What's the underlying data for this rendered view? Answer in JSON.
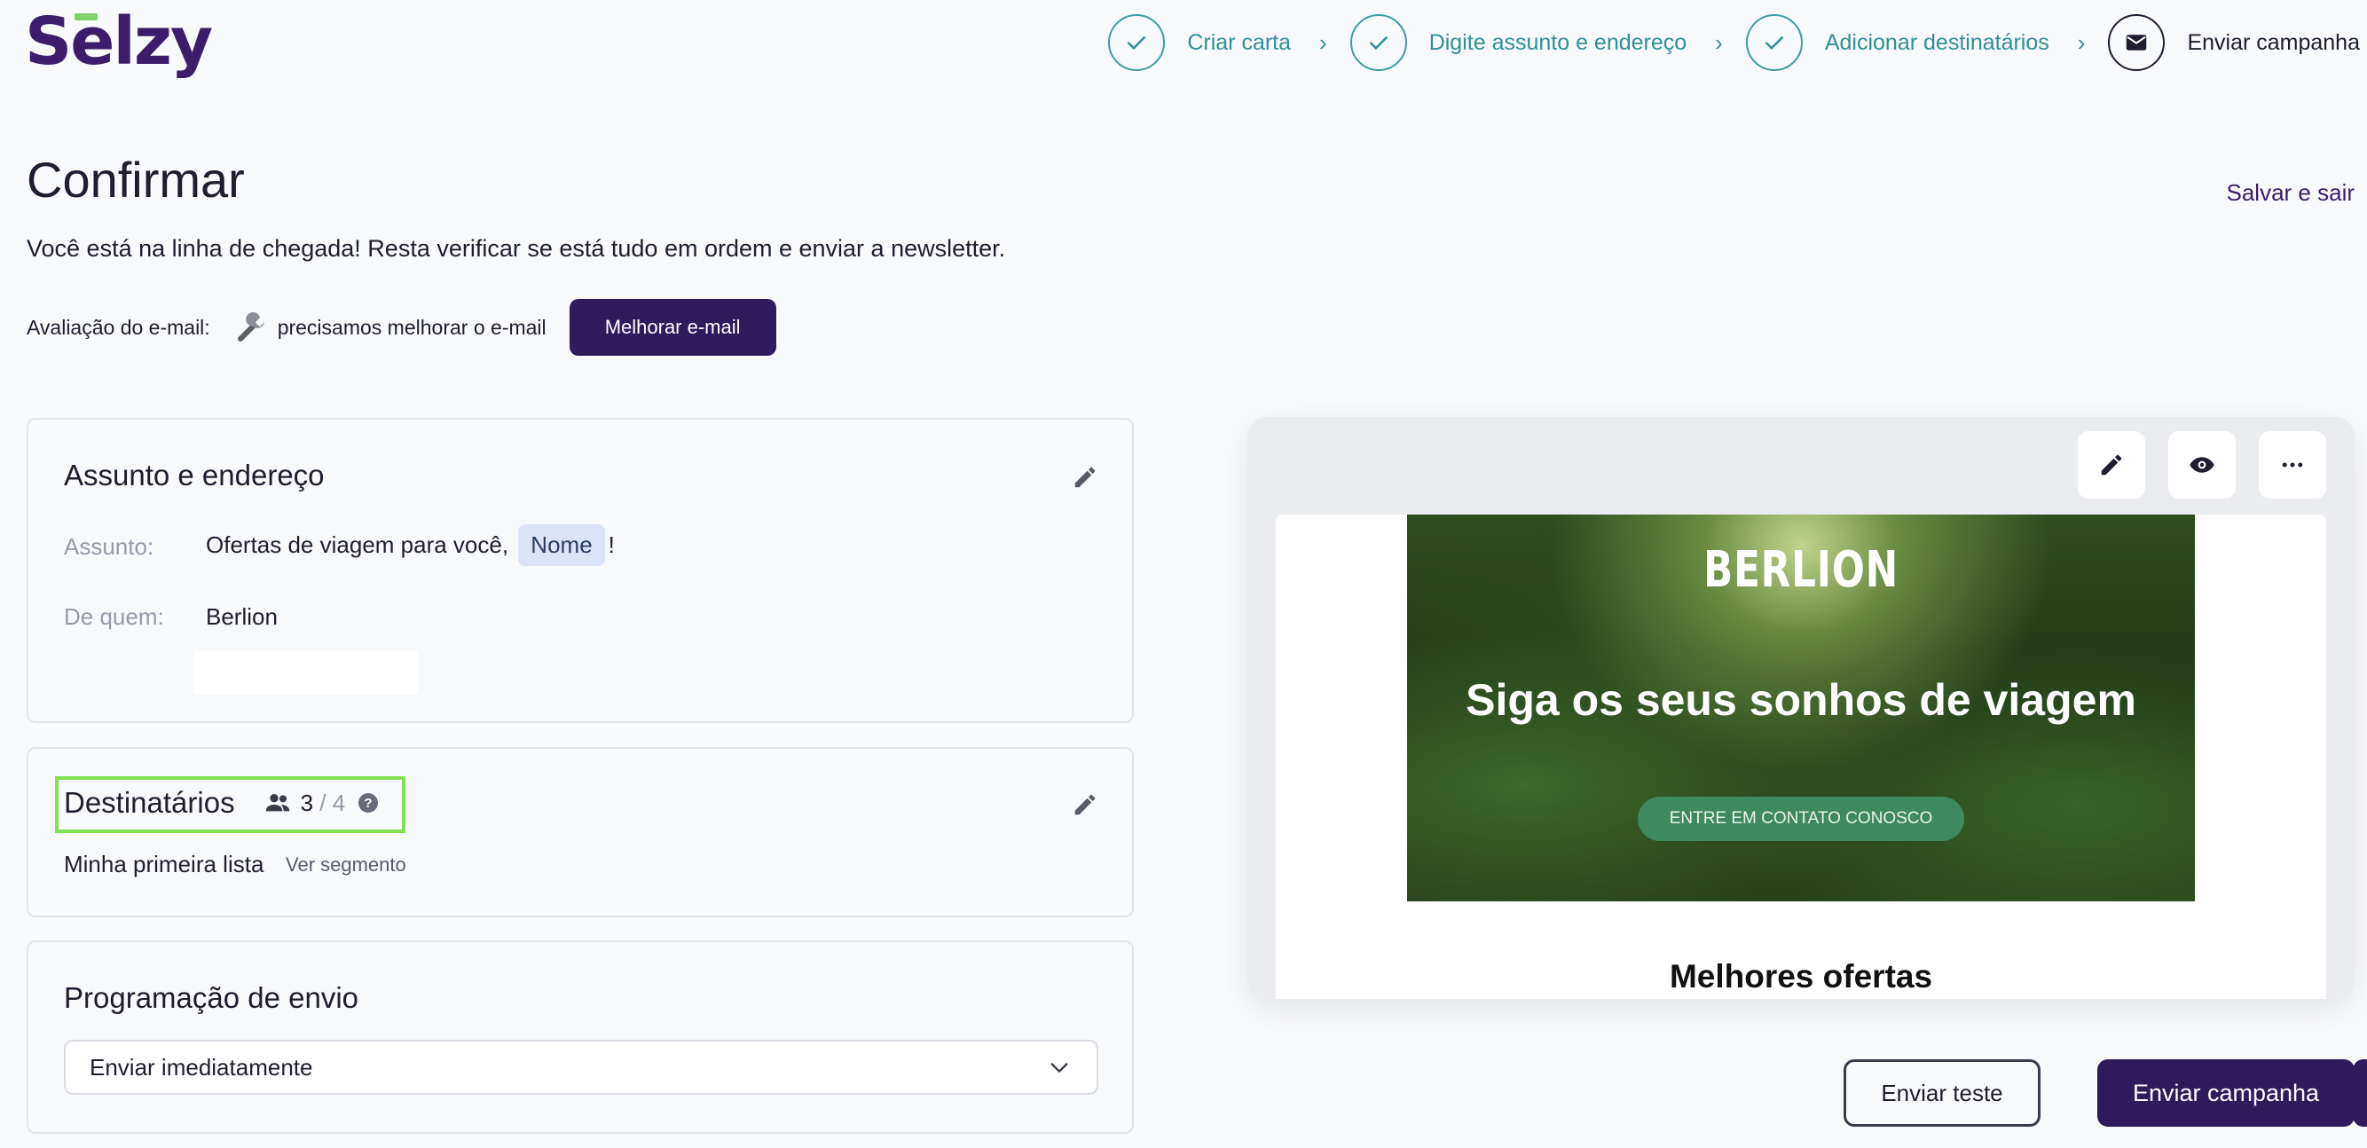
{
  "brand": {
    "logo": "Selzy"
  },
  "steps": [
    {
      "label": "Criar carta",
      "status": "done"
    },
    {
      "label": "Digite assunto e endereço",
      "status": "done"
    },
    {
      "label": "Adicionar destinatários",
      "status": "done"
    },
    {
      "label": "Enviar campanha",
      "status": "current"
    }
  ],
  "page": {
    "title": "Confirmar",
    "save_exit": "Salvar e sair",
    "subtitle": "Você está na linha de chegada! Resta verificar se está tudo em ordem e enviar a newsletter."
  },
  "rating": {
    "label": "Avaliação do e-mail:",
    "status": "precisamos melhorar o e-mail",
    "button": "Melhorar e-mail"
  },
  "subject_card": {
    "title": "Assunto e endereço",
    "subject_label": "Assunto:",
    "subject_value": "Ofertas de viagem para você,",
    "subject_tag": "Nome",
    "subject_suffix": "!",
    "from_label": "De quem:",
    "from_value": "Berlion"
  },
  "recipients_card": {
    "title": "Destinatários",
    "count": "3",
    "separator": "/",
    "total": "4",
    "list_name": "Minha primeira lista",
    "segment_link": "Ver segmento"
  },
  "schedule_card": {
    "title": "Programação de envio",
    "selected": "Enviar imediatamente"
  },
  "preview": {
    "brand": "BERLION",
    "headline": "Siga os seus sonhos de viagem",
    "cta": "ENTRE EM CONTATO CONOSCO",
    "section_title": "Melhores ofertas"
  },
  "actions": {
    "send_test": "Enviar teste",
    "send_campaign": "Enviar campanha"
  },
  "colors": {
    "primary": "#2f1a5c",
    "step_done": "#2f8f97",
    "highlight": "#7fe24e",
    "cta_green": "#3e8a5d"
  }
}
